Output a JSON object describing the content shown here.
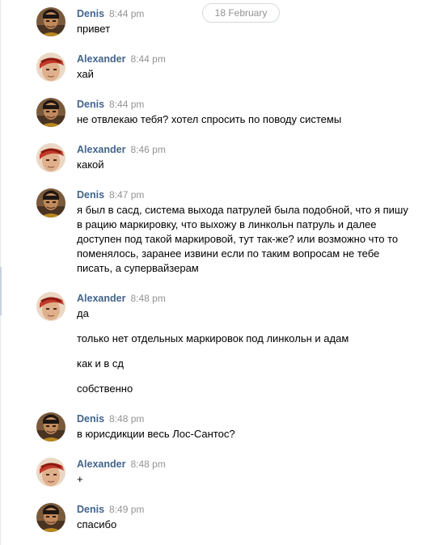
{
  "date_separator": "18 February",
  "messages": [
    {
      "author": "Denis",
      "time": "8:44 pm",
      "avatar": "denis-avatar",
      "paragraphs": [
        "привет"
      ]
    },
    {
      "author": "Alexander",
      "time": "8:44 pm",
      "avatar": "alexander-avatar",
      "paragraphs": [
        "хай"
      ]
    },
    {
      "author": "Denis",
      "time": "8:44 pm",
      "avatar": "denis-avatar",
      "paragraphs": [
        "не отвлекаю тебя? хотел спросить по поводу системы"
      ]
    },
    {
      "author": "Alexander",
      "time": "8:46 pm",
      "avatar": "alexander-avatar",
      "paragraphs": [
        "какой"
      ]
    },
    {
      "author": "Denis",
      "time": "8:47 pm",
      "avatar": "denis-avatar",
      "paragraphs": [
        "я был в сасд, система выхода патрулей была подобной, что я пишу в рацию маркировку, что выхожу в линкольн патруль и далее доступен под такой маркировой, тут так-же? или возможно что то поменялось, заранее извини если по таким вопросам не тебе писать, а супервайзерам"
      ]
    },
    {
      "author": "Alexander",
      "time": "8:48 pm",
      "avatar": "alexander-avatar",
      "paragraphs": [
        "да",
        "только нет отдельных маркировок под линкольн и адам",
        "как и в сд",
        "собственно"
      ]
    },
    {
      "author": "Denis",
      "time": "8:48 pm",
      "avatar": "denis-avatar",
      "paragraphs": [
        "в юрисдикции весь Лос-Сантос?"
      ]
    },
    {
      "author": "Alexander",
      "time": "8:48 pm",
      "avatar": "alexander-avatar",
      "paragraphs": [
        "+"
      ]
    },
    {
      "author": "Denis",
      "time": "8:49 pm",
      "avatar": "denis-avatar",
      "paragraphs": [
        "спасибо"
      ]
    }
  ]
}
